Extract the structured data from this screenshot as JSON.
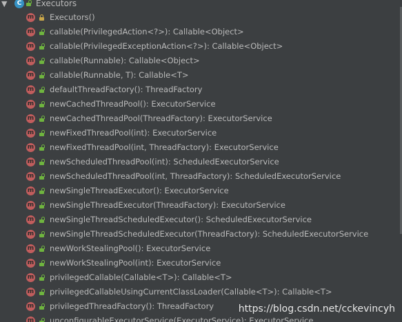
{
  "header": {
    "expand_glyph": "▼",
    "class_badge": "C",
    "title": "Executors"
  },
  "method_badge": "m",
  "members": [
    {
      "label": "Executors()",
      "lock": "private"
    },
    {
      "label": "callable(PrivilegedAction<?>): Callable<Object>",
      "lock": "public"
    },
    {
      "label": "callable(PrivilegedExceptionAction<?>): Callable<Object>",
      "lock": "public"
    },
    {
      "label": "callable(Runnable): Callable<Object>",
      "lock": "public"
    },
    {
      "label": "callable(Runnable, T): Callable<T>",
      "lock": "public"
    },
    {
      "label": "defaultThreadFactory(): ThreadFactory",
      "lock": "public"
    },
    {
      "label": "newCachedThreadPool(): ExecutorService",
      "lock": "public"
    },
    {
      "label": "newCachedThreadPool(ThreadFactory): ExecutorService",
      "lock": "public"
    },
    {
      "label": "newFixedThreadPool(int): ExecutorService",
      "lock": "public"
    },
    {
      "label": "newFixedThreadPool(int, ThreadFactory): ExecutorService",
      "lock": "public"
    },
    {
      "label": "newScheduledThreadPool(int): ScheduledExecutorService",
      "lock": "public"
    },
    {
      "label": "newScheduledThreadPool(int, ThreadFactory): ScheduledExecutorService",
      "lock": "public"
    },
    {
      "label": "newSingleThreadExecutor(): ExecutorService",
      "lock": "public"
    },
    {
      "label": "newSingleThreadExecutor(ThreadFactory): ExecutorService",
      "lock": "public"
    },
    {
      "label": "newSingleThreadScheduledExecutor(): ScheduledExecutorService",
      "lock": "public"
    },
    {
      "label": "newSingleThreadScheduledExecutor(ThreadFactory): ScheduledExecutorService",
      "lock": "public"
    },
    {
      "label": "newWorkStealingPool(): ExecutorService",
      "lock": "public"
    },
    {
      "label": "newWorkStealingPool(int): ExecutorService",
      "lock": "public"
    },
    {
      "label": "privilegedCallable(Callable<T>): Callable<T>",
      "lock": "public"
    },
    {
      "label": "privilegedCallableUsingCurrentClassLoader(Callable<T>): Callable<T>",
      "lock": "public"
    },
    {
      "label": "privilegedThreadFactory(): ThreadFactory",
      "lock": "public"
    },
    {
      "label": "unconfigurableExecutorService(ExecutorService): ExecutorService",
      "lock": "public"
    }
  ],
  "watermark": "https://blog.csdn.net/cckevincyh",
  "colors": {
    "background": "#3c3f41",
    "text": "#bbbbbb",
    "class_icon": "#3592c4",
    "method_icon": "#c15d5d",
    "private_lock": "#c9a74a",
    "public_lock": "#6fb43f"
  }
}
